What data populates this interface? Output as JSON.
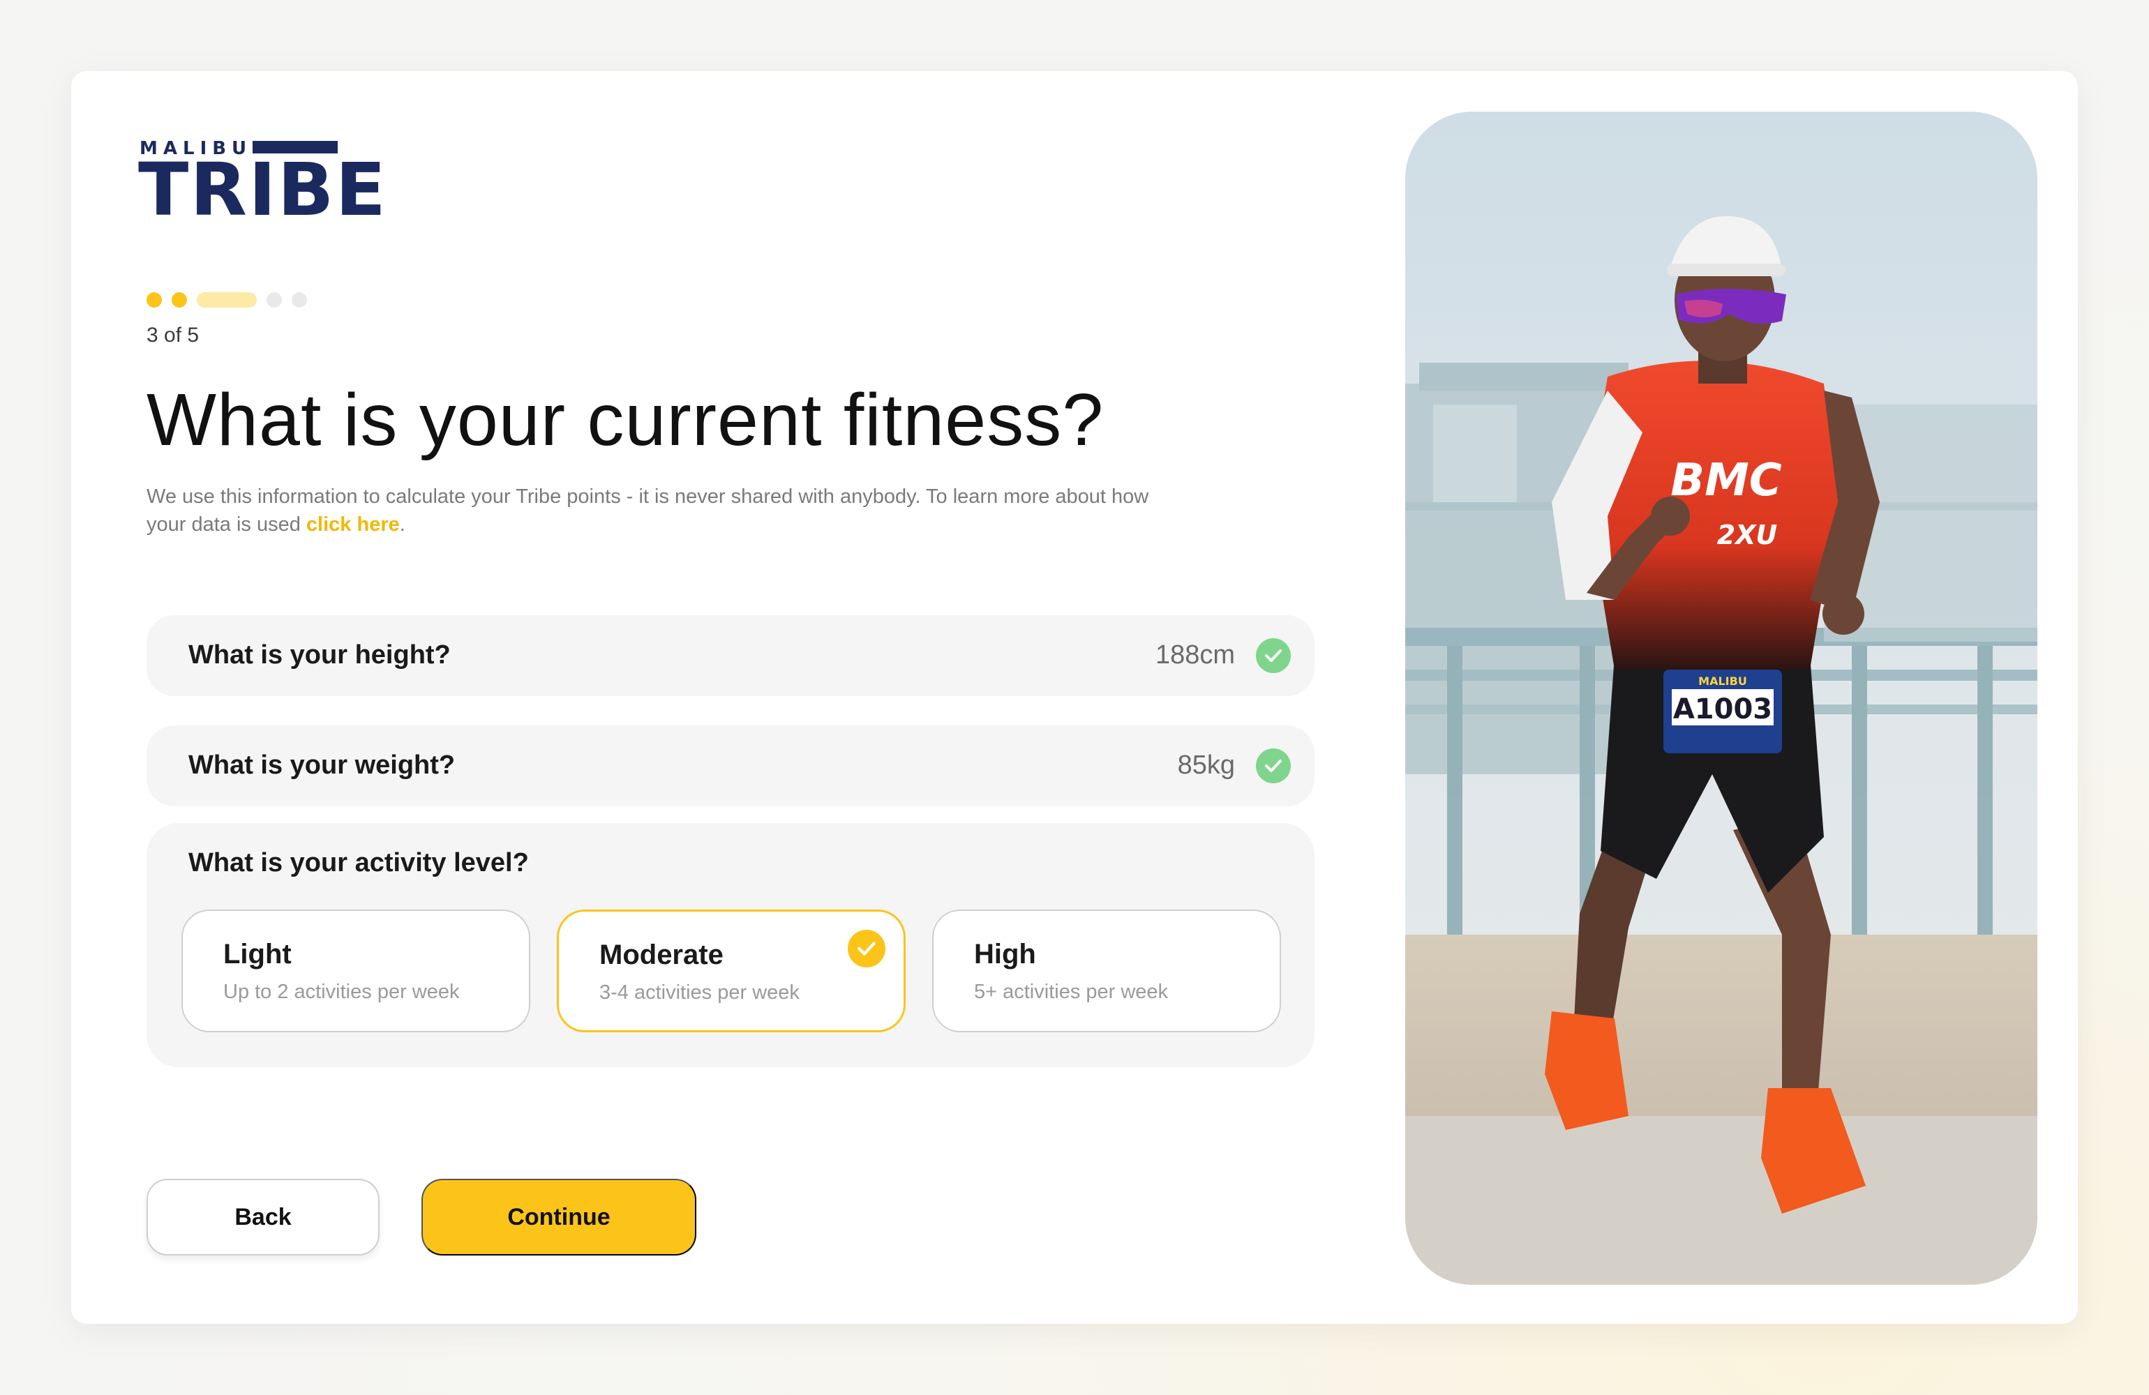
{
  "brand": {
    "small": "MALIBU",
    "big": "TRIBE"
  },
  "progress": {
    "label": "3 of 5",
    "total": 5,
    "current": 3
  },
  "title": "What is your current fitness?",
  "description": {
    "text": "We use this information to calculate your Tribe points - it is never shared with anybody. To learn more about how your data is used ",
    "link": "click here",
    "end": "."
  },
  "questions": [
    {
      "label": "What is your height?",
      "value": "188cm"
    },
    {
      "label": "What is your weight?",
      "value": "85kg"
    }
  ],
  "activity": {
    "label": "What is your activity level?",
    "options": [
      {
        "name": "Light",
        "sub": "Up to 2 activities per week"
      },
      {
        "name": "Moderate",
        "sub": "3-4 activities per week"
      },
      {
        "name": "High",
        "sub": "5+ activities per week"
      }
    ],
    "selected": "Moderate"
  },
  "buttons": {
    "back": "Back",
    "continue": "Continue"
  },
  "photo": {
    "bib_number": "A1003",
    "bib_event": "MALIBU",
    "jersey_text": "BMC",
    "jersey_sub": "2XU"
  },
  "colors": {
    "accent": "#fcc419",
    "success": "#7fd58b",
    "brand": "#1b2a5e"
  }
}
